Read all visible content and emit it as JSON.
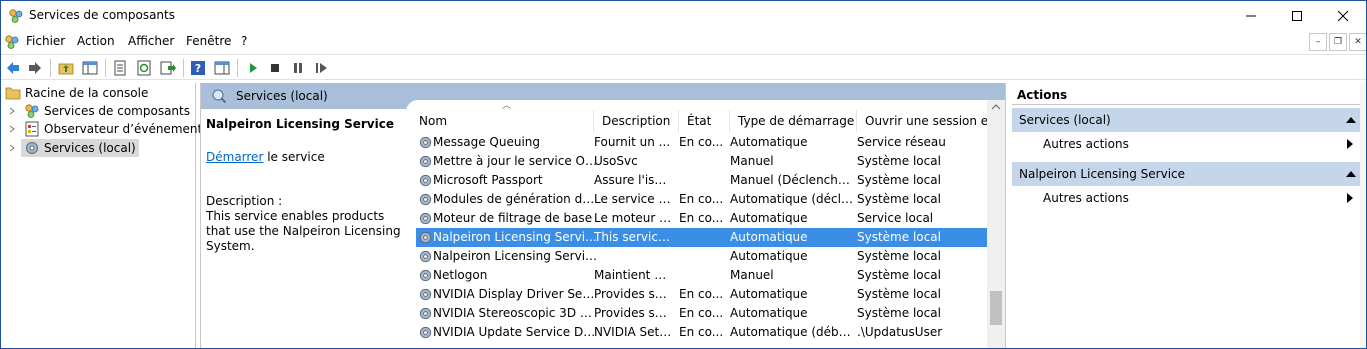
{
  "window": {
    "title": "Services de composants"
  },
  "menu": {
    "items": [
      "Fichier",
      "Action",
      "Afficher",
      "Fenêtre",
      "?"
    ]
  },
  "tree": {
    "items": [
      {
        "label": "Racine de la console"
      },
      {
        "label": "Services de composants"
      },
      {
        "label": "Observateur d’événements ("
      },
      {
        "label": "Services (local)"
      }
    ]
  },
  "center": {
    "header": "Services (local)",
    "extended": {
      "title": "Nalpeiron Licensing Service",
      "link": "Démarrer",
      "link_suffix": " le service",
      "description_label": "Description :",
      "description": "This service enables products that use the Nalpeiron Licensing System."
    },
    "columns": [
      "Nom",
      "Description",
      "État",
      "Type de démarrage",
      "Ouvrir une session en tant que"
    ],
    "rows": [
      {
        "name": "Message Queuing",
        "description": "Fournit un ...",
        "state": "En co...",
        "startup": "Automatique",
        "logon": "Service réseau"
      },
      {
        "name": "Mettre à jour le service Orc...",
        "description": "UsoSvc",
        "state": "",
        "startup": "Manuel",
        "logon": "Système local"
      },
      {
        "name": "Microsoft Passport",
        "description": "Assure l'isol...",
        "state": "",
        "startup": "Manuel (Déclencher...",
        "logon": "Système local"
      },
      {
        "name": "Modules de génération de c...",
        "description": "Le service IK...",
        "state": "En co...",
        "startup": "Automatique (décle...",
        "logon": "Système local"
      },
      {
        "name": "Moteur de filtrage de base",
        "description": "Le moteur d...",
        "state": "En co...",
        "startup": "Automatique",
        "logon": "Service local"
      },
      {
        "name": "Nalpeiron Licensing Service",
        "description": "This service ...",
        "state": "",
        "startup": "Automatique",
        "logon": "Système local",
        "selected": true
      },
      {
        "name": "Nalpeiron Licensing Service...",
        "description": "",
        "state": "",
        "startup": "Automatique",
        "logon": "Système local"
      },
      {
        "name": "Netlogon",
        "description": "Maintient u...",
        "state": "",
        "startup": "Manuel",
        "logon": "Système local"
      },
      {
        "name": "NVIDIA Display Driver Service",
        "description": "Provides sys...",
        "state": "En co...",
        "startup": "Automatique",
        "logon": "Système local"
      },
      {
        "name": "NVIDIA Stereoscopic 3D Dri...",
        "description": "Provides sys...",
        "state": "En co...",
        "startup": "Automatique",
        "logon": "Système local"
      },
      {
        "name": "NVIDIA Update Service Dae...",
        "description": "NVIDIA Setti...",
        "state": "En co...",
        "startup": "Automatique (débu...",
        "logon": ".\\UpdatusUser"
      }
    ]
  },
  "actions": {
    "header": "Actions",
    "sections": [
      {
        "title": "Services (local)",
        "item": "Autres actions"
      },
      {
        "title": "Nalpeiron Licensing Service",
        "item": "Autres actions"
      }
    ]
  },
  "colors": {
    "selection": "#3a8ee6",
    "panel_header": "#a9bfd9",
    "action_section": "#c6d6ea"
  }
}
